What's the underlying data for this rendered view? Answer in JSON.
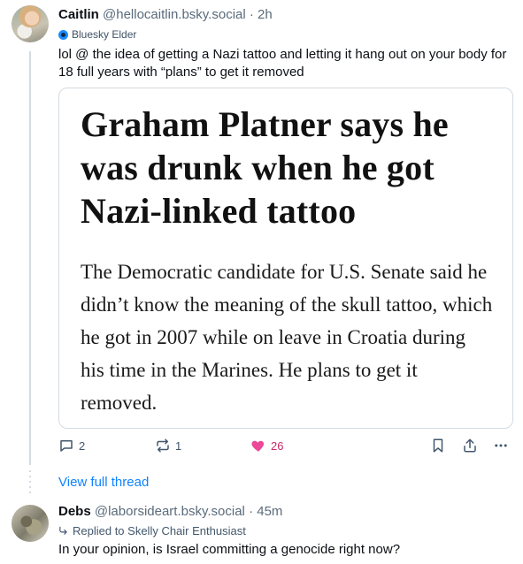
{
  "post1": {
    "author_name": "Caitlin",
    "handle": "@hellocaitlin.bsky.social",
    "separator": "·",
    "time": "2h",
    "badge": "Bluesky Elder",
    "text": "lol @ the idea of getting a Nazi tattoo and letting it hang out on your body for 18 full years with “plans” to get it removed",
    "embed": {
      "title": "Graham Platner says he was drunk when he got Nazi-linked tattoo",
      "body": "The Democratic candidate for U.S. Senate said he didn’t know the meaning of the skull tattoo, which he got in 2007 while on leave in Croatia during his time in the Marines. He plans to get it removed."
    },
    "actions": {
      "reply_count": "2",
      "repost_count": "1",
      "like_count": "26"
    }
  },
  "view_full_thread": "View full thread",
  "post2": {
    "author_name": "Debs",
    "handle": "@laborsideart.bsky.social",
    "separator": "·",
    "time": "45m",
    "reply_context": "Replied to Skelly Chair Enthusiast",
    "text": "In your opinion, is Israel committing a genocide right now?"
  },
  "colors": {
    "accent": "#1083fe",
    "like": "#ec4899",
    "muted": "#5a6b7b"
  }
}
